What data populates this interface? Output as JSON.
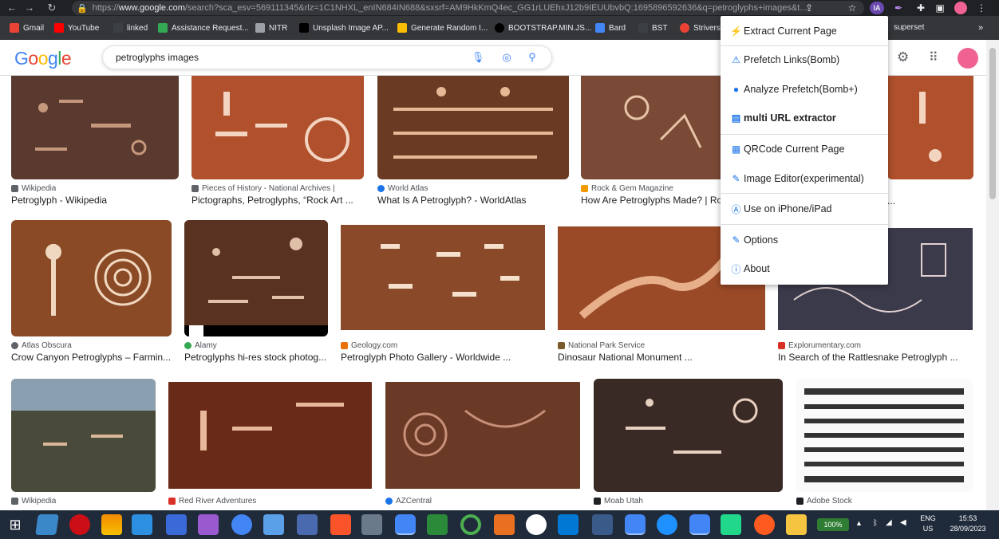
{
  "browser": {
    "url_prefix": "https://",
    "url_domain": "www.google.com",
    "url_rest": "/search?sca_esv=569111345&rlz=1C1NHXL_enIN684IN688&sxsrf=AM9HkKmQ4ec_GG1rLUEhxJ12b9IEUUbvbQ:1695896592636&q=petroglyphs+images&t...",
    "profile_badge": "IA"
  },
  "bookmarks": [
    {
      "label": "Gmail",
      "color": "#ea4335"
    },
    {
      "label": "YouTube",
      "color": "#ff0000"
    },
    {
      "label": "linked",
      "color": "#3c4043"
    },
    {
      "label": "Assistance Request...",
      "color": "#34a853"
    },
    {
      "label": "NITR",
      "color": "#9aa0a6"
    },
    {
      "label": "Unsplash Image AP...",
      "color": "#202124"
    },
    {
      "label": "Generate Random I...",
      "color": "#fbbc04"
    },
    {
      "label": "BOOTSTRAP.MIN.JS...",
      "color": "#202124"
    },
    {
      "label": "Bard",
      "color": "#4285f4"
    },
    {
      "label": "BST",
      "color": "#3c4043"
    },
    {
      "label": "Strivers",
      "color": "#ea4335"
    },
    {
      "label": "superset",
      "color": "#35363a"
    }
  ],
  "search": {
    "logo": "Google",
    "query": "petroglyphs images"
  },
  "extension_menu": {
    "items": [
      {
        "label": "Extract Current Page",
        "icon": "bolt-icon",
        "glyph": "⚡"
      },
      {
        "label": "Prefetch Links(Bomb)",
        "icon": "warning-icon",
        "glyph": "⚠"
      },
      {
        "label": "Analyze Prefetch(Bomb+)",
        "icon": "bomb-icon",
        "glyph": "●"
      },
      {
        "label": "multi URL extractor",
        "icon": "list-icon",
        "glyph": "▤"
      },
      {
        "label": "QRCode Current Page",
        "icon": "qrcode-icon",
        "glyph": "▦"
      },
      {
        "label": "Image Editor(experimental)",
        "icon": "edit-icon",
        "glyph": "✎"
      },
      {
        "label": "Use on iPhone/iPad",
        "icon": "app-store-icon",
        "glyph": "Ⓐ"
      },
      {
        "label": "Options",
        "icon": "wrench-icon",
        "glyph": "🔧"
      },
      {
        "label": "About",
        "icon": "info-icon",
        "glyph": "ⓘ"
      }
    ]
  },
  "results": [
    {
      "source": "Wikipedia",
      "title": "Petroglyph - Wikipedia",
      "icon_color": "#5f6368",
      "bg": "#5a3a2e"
    },
    {
      "source": "Pieces of History - National Archives |",
      "title": "Pictographs, Petroglyphs, “Rock Art ...",
      "icon_color": "#5f6368",
      "bg": "#b0502c"
    },
    {
      "source": "World Atlas",
      "title": "What Is A Petroglyph? - WorldAtlas",
      "icon_color": "#1a73e8",
      "bg": "#6a3a22"
    },
    {
      "source": "Rock & Gem Magazine",
      "title": "How Are Petroglyphs Made? | Ro",
      "icon_color": "#f29900",
      "bg": "#7a4a36"
    },
    {
      "source": "",
      "title": "...",
      "icon_color": "#5f6368",
      "bg": "#b0502c"
    },
    {
      "source": "Atlas Obscura",
      "title": "Crow Canyon Petroglyphs – Farmin...",
      "icon_color": "#5f6368",
      "bg": "#8a4a26"
    },
    {
      "source": "Alamy",
      "title": "Petroglyphs hi-res stock photog...",
      "icon_color": "#34a853",
      "bg": "#5a3222"
    },
    {
      "source": "Geology.com",
      "title": "Petroglyph Photo Gallery - Worldwide ...",
      "icon_color": "#e8710a",
      "bg": "#8a4a2a"
    },
    {
      "source": "National Park Service",
      "title": "Dinosaur National Monument ...",
      "icon_color": "#7a5a2a",
      "bg": "#9a4a26"
    },
    {
      "source": "Explorumentary.com",
      "title": "In Search of the Rattlesnake Petroglyph ...",
      "icon_color": "#d93025",
      "bg": "#3a3a4a"
    },
    {
      "source": "Wikipedia",
      "title": "",
      "icon_color": "#5f6368",
      "bg": "#4a4a3a"
    },
    {
      "source": "Red River Adventures",
      "title": "",
      "icon_color": "#d93025",
      "bg": "#6a2a18"
    },
    {
      "source": "AZCentral",
      "title": "",
      "icon_color": "#1a73e8",
      "bg": "#6a3a26"
    },
    {
      "source": "Moab Utah",
      "title": "",
      "icon_color": "#202124",
      "bg": "#3a2a26"
    },
    {
      "source": "Adobe Stock",
      "title": "",
      "icon_color": "#202124",
      "bg": "#fafafa"
    }
  ],
  "taskbar": {
    "battery": "100%",
    "lang": "ENG",
    "region": "US",
    "time": "15:53",
    "date": "28/09/2023"
  },
  "colors": {
    "accent": "#1a73e8",
    "chrome_dark": "#202124",
    "taskbar": "#1f2a3b"
  }
}
